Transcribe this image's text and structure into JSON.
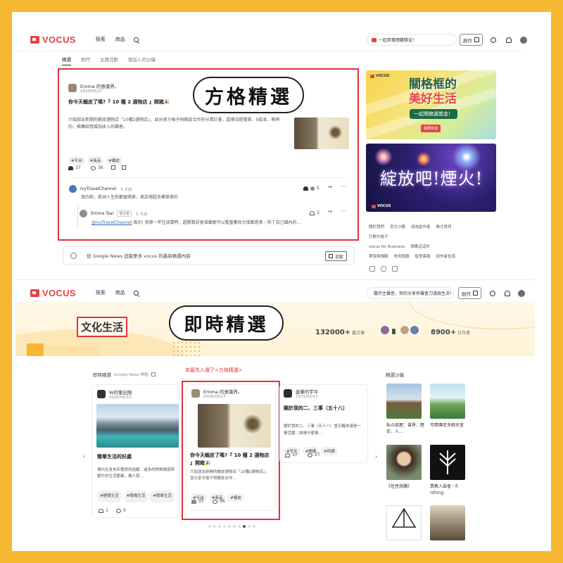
{
  "brand": {
    "name": "vocus",
    "accent": "#e24648",
    "frame_color": "#f8b731",
    "highlight": "#e0333b"
  },
  "header": {
    "nav": [
      "探索",
      "商品"
    ],
    "promo1": "一起來寬閱籍獎金！",
    "promo2": "聽宗主聲音，你的分享有機會刀淺撿生活！",
    "create_label": "創作"
  },
  "tabs": [
    "精選",
    "熱門",
    "主題活動",
    "我加入的沙龍"
  ],
  "labels": {
    "square_picks": "方格精選",
    "realtime_picks": "即時精選",
    "culture": "文化生活",
    "selected_note": "本篇先入選了<方格精選>"
  },
  "main_post": {
    "author": "Emma 的意識界。",
    "date": "2025/05/17",
    "title": "你今天蝦皮了嗎?『 10 種 2 選物店 』開箱🎉",
    "body": "介紹朋友新開的蝦皮選物店「10種2選物店」，並分享方格子與蝦皮合作的分潤計畫，超導流程簡單，0成本、無時的，推薦給想增加收入的讀者。",
    "tags": [
      "#平台",
      "#商品",
      "#蝦皮"
    ],
    "likes": "37",
    "comments": "36"
  },
  "comments": [
    {
      "user": "IvyTravelChannel",
      "when": "6 天前",
      "text": "真的欸，歌洲人生我都蠻喝茶，鼻店裡超多藥草茶的",
      "likes": "5"
    },
    {
      "user": "Emma Tsai",
      "badge": "發文者",
      "when": "6 天前",
      "mention": "@IvyTravelChannel",
      "text": " 真的! 我第一年往波蘭時，超精驚訝會增聲麼可以看整藥尚大俤都意茶｜除了自己國內的…",
      "likes": "3"
    }
  ],
  "gnews": {
    "text": "從 Google News 追蹤更多 vocus 的最新精選內容",
    "button": "追蹤"
  },
  "banner1": {
    "title_a": "關格框的",
    "title_b": "美好生活",
    "subtitle": "一起開箱選獎金！",
    "cta": "我要參加",
    "logo": "VOCUS"
  },
  "banner2": {
    "title": "綻放吧!煙火!",
    "logo": "VOCUS"
  },
  "footer": {
    "rows": [
      [
        "關於我們",
        "官方沙龍",
        "成為創作者",
        "徵才資訊"
      ],
      [
        "打開方格子"
      ],
      [
        "vocus for Business",
        "頭案這這計"
      ],
      [
        "帶我與規範",
        "常見問題",
        "智慧客服",
        "創作者告南"
      ]
    ]
  },
  "hero": {
    "articles": "132000+",
    "articles_unit": "篇文章",
    "creators": "8900+",
    "creators_unit": "位作者"
  },
  "realtime": {
    "heading": "即時精選",
    "gnews": "Google News 焦點"
  },
  "cards": [
    {
      "author": "W的筆記簡",
      "date": "2025/05/15",
      "title": "簡單生活的好處",
      "body": "現代社會充斥著資訊過載、過多的物質誘惑與繁忙的生活節奏，讓人感…",
      "tags": [
        "#極簡生活",
        "#簡樸生活",
        "#簡單生活"
      ],
      "likes": "1",
      "comments": "0"
    },
    {
      "author": "Emma 的意識界。",
      "date": "2025/05/17",
      "title": "你今天蝦皮了嗎?『 10 種 2 選物店 』開箱🎉",
      "body": "介紹朋友新開的蝦皮選物店「10種2選物店」，並分享方格子與蝦皮合作…",
      "tags": [
        "#平台",
        "#商品",
        "#蝦皮"
      ],
      "likes": "37",
      "comments": "36"
    },
    {
      "author": "進擊的宇牛",
      "date": "2025/05/17",
      "title": "關於我的二、三事（五十八）",
      "body": "關於我的二、三事（五十八）當天醒來還是一樣活躍｜該做什麼事…",
      "tags": [
        "#宇牛",
        "#媽媽",
        "#同鄉"
      ],
      "likes": "37",
      "comments": "27"
    }
  ],
  "salon": {
    "heading": "精選沙龍",
    "items": [
      {
        "caption": "私の部屋：曾界、歷史、人…"
      },
      {
        "caption": "可精傳老多聊天室"
      },
      {
        "caption": "《任性商購》"
      },
      {
        "caption": "異教人語會・fi nthing"
      }
    ]
  },
  "pager": {
    "count": 10,
    "active": 7
  }
}
